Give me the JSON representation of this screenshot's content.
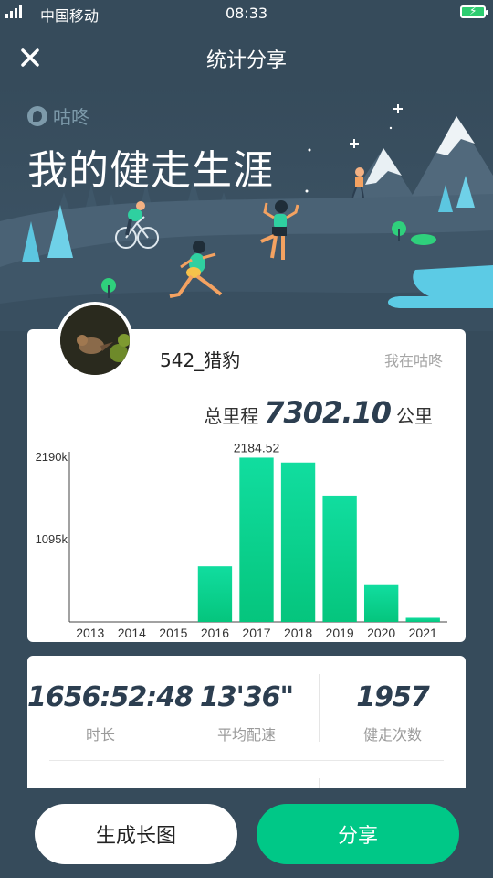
{
  "status_bar": {
    "carrier": "中国移动",
    "network": "4G 4G",
    "time": "08:33"
  },
  "nav": {
    "title": "统计分享"
  },
  "hero": {
    "brand_name": "咕咚",
    "title": "我的健走生涯"
  },
  "profile": {
    "username": "542_猎豹",
    "tagline": "我在咕咚"
  },
  "summary": {
    "label": "总里程",
    "value": "7302.10",
    "unit": "公里"
  },
  "chart_data": {
    "type": "bar",
    "categories": [
      "2013",
      "2014",
      "2015",
      "2016",
      "2017",
      "2018",
      "2019",
      "2020",
      "2021"
    ],
    "values": [
      0,
      0,
      0,
      740,
      2184.52,
      2120,
      1680,
      490,
      55
    ],
    "ylim": [
      0,
      2190
    ],
    "yticks": [
      "2190k",
      "1095k"
    ],
    "ytick_values": [
      2190,
      1095
    ],
    "data_labels": [
      {
        "index": 4,
        "text": "2184.52"
      }
    ],
    "bar_color": "#0dd495",
    "grid": false
  },
  "stats": [
    {
      "value": "1656:52:48",
      "label": "时长"
    },
    {
      "value": "13'36\"",
      "label": "平均配速"
    },
    {
      "value": "1957",
      "label": "健走次数"
    }
  ],
  "buttons": {
    "long_image": "生成长图",
    "share": "分享"
  },
  "colors": {
    "background": "#364b5b",
    "accent": "#00c887",
    "card": "#ffffff"
  }
}
